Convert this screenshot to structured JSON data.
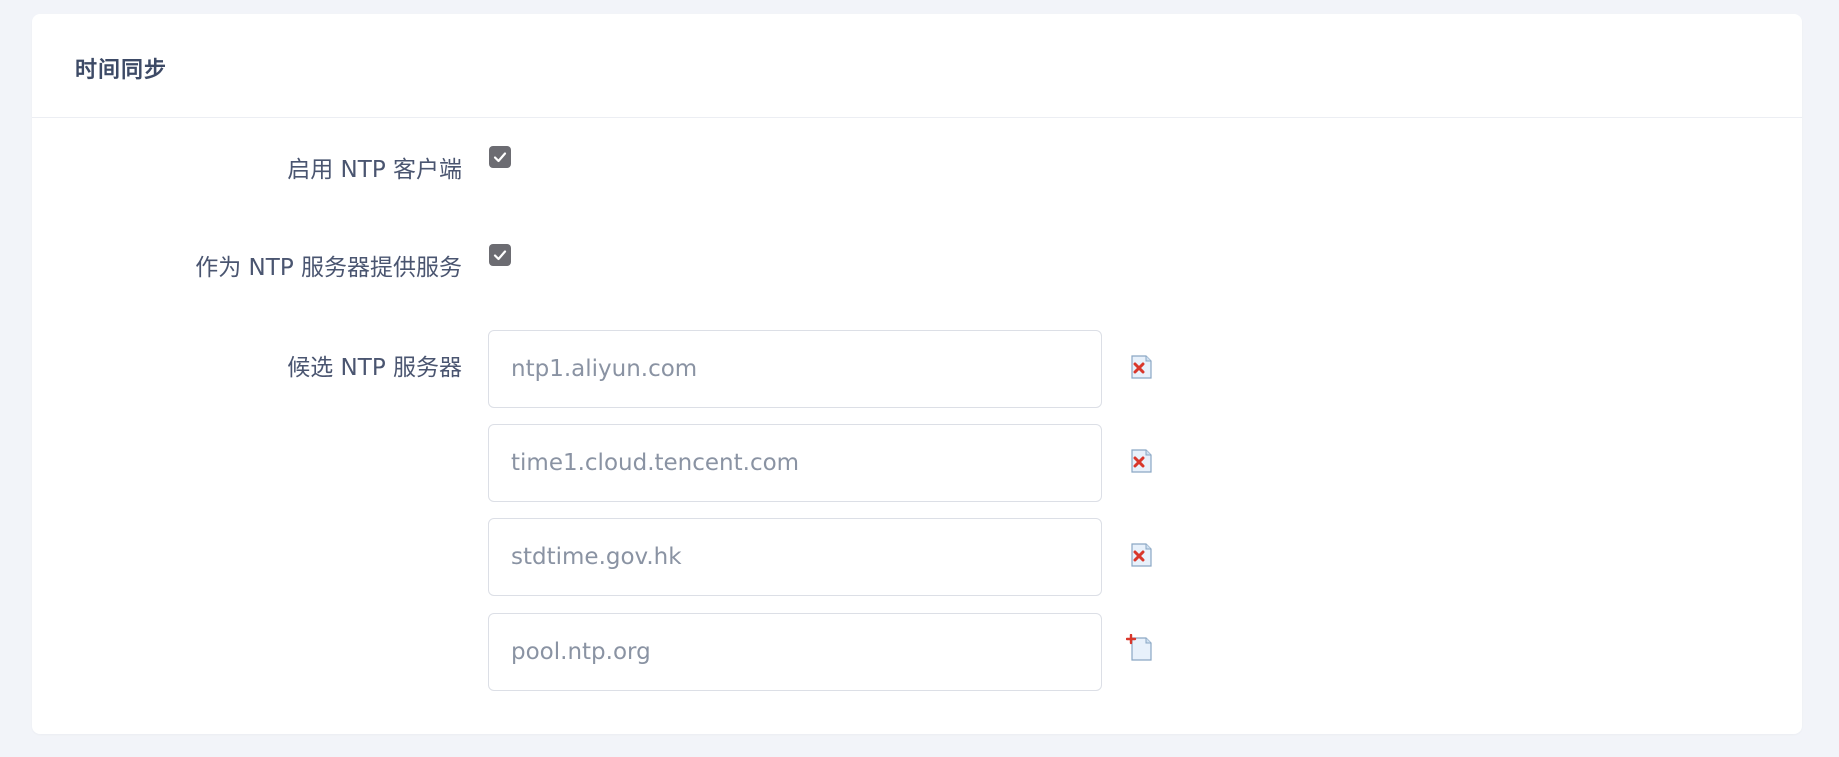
{
  "card": {
    "title": "时间同步"
  },
  "form": {
    "enable_client": {
      "label": "启用 NTP 客户端",
      "checked": true
    },
    "provide_server": {
      "label": "作为 NTP 服务器提供服务",
      "checked": true
    },
    "candidate_servers": {
      "label": "候选 NTP 服务器",
      "items": [
        {
          "value": "ntp1.aliyun.com",
          "action": "remove-icon"
        },
        {
          "value": "time1.cloud.tencent.com",
          "action": "remove-icon"
        },
        {
          "value": "stdtime.gov.hk",
          "action": "remove-icon"
        },
        {
          "value": "pool.ntp.org",
          "action": "add-icon"
        }
      ]
    }
  },
  "colors": {
    "background": "#f2f4f9",
    "card": "#ffffff",
    "checkbox": "#6c6c72",
    "label_text": "#4a5570",
    "input_text": "#8a93a3",
    "remove_icon": "#d9372b"
  }
}
